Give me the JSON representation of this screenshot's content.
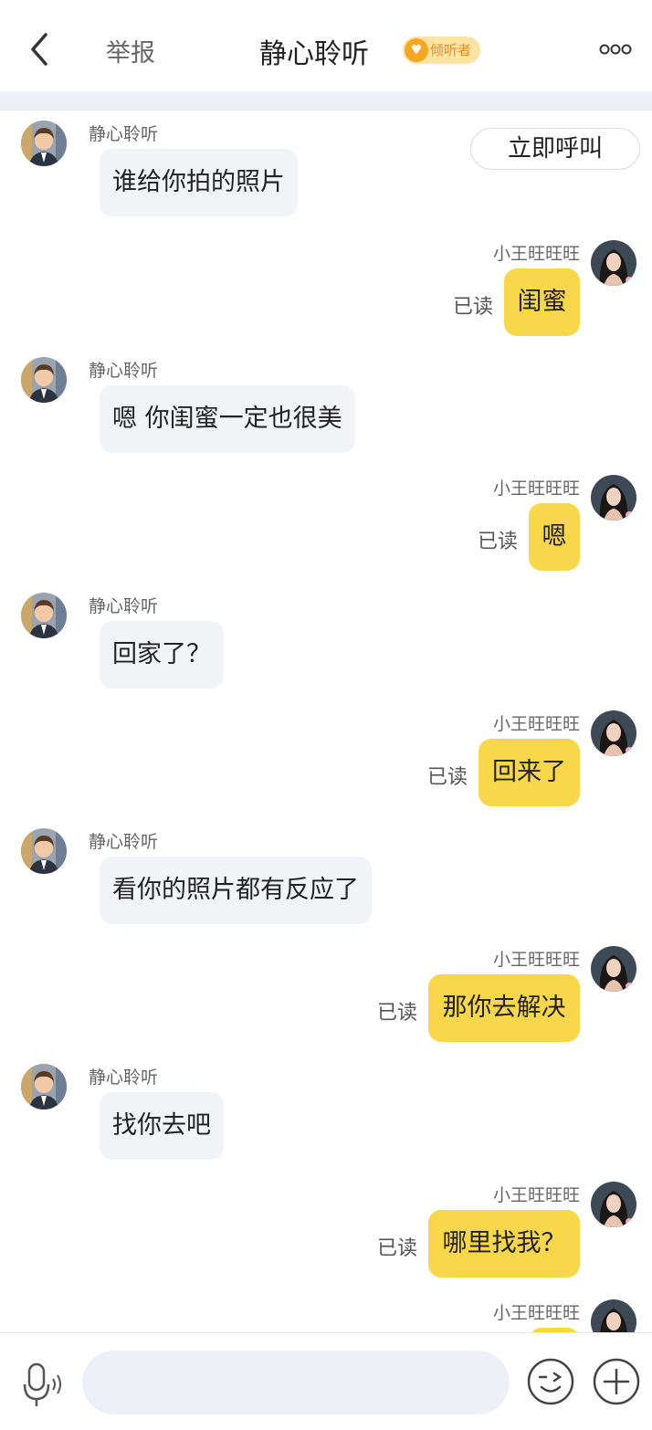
{
  "header": {
    "report_label": "举报",
    "title": "静心聆听",
    "badge_label": "倾听者"
  },
  "call_button_label": "立即呼叫",
  "read_label": "已读",
  "other_name": "静心聆听",
  "my_name": "小王旺旺旺",
  "messages": [
    {
      "side": "left",
      "text": "谁给你拍的照片"
    },
    {
      "side": "right",
      "text": "闺蜜"
    },
    {
      "side": "left",
      "text": "嗯  你闺蜜一定也很美"
    },
    {
      "side": "right",
      "text": "嗯"
    },
    {
      "side": "left",
      "text": "回家了？"
    },
    {
      "side": "right",
      "text": "回来了"
    },
    {
      "side": "left",
      "text": "看你的照片都有反应了"
    },
    {
      "side": "right",
      "text": "那你去解决"
    },
    {
      "side": "left",
      "text": "找你去吧"
    },
    {
      "side": "right",
      "text": "哪里找我？"
    },
    {
      "side": "right",
      "text": ""
    }
  ],
  "input": {
    "placeholder": ""
  },
  "colors": {
    "my_bubble": "#f8d74a",
    "other_bubble": "#f2f3f7",
    "badge_bg": "#fde3a4",
    "badge_text": "#f08a1a"
  }
}
